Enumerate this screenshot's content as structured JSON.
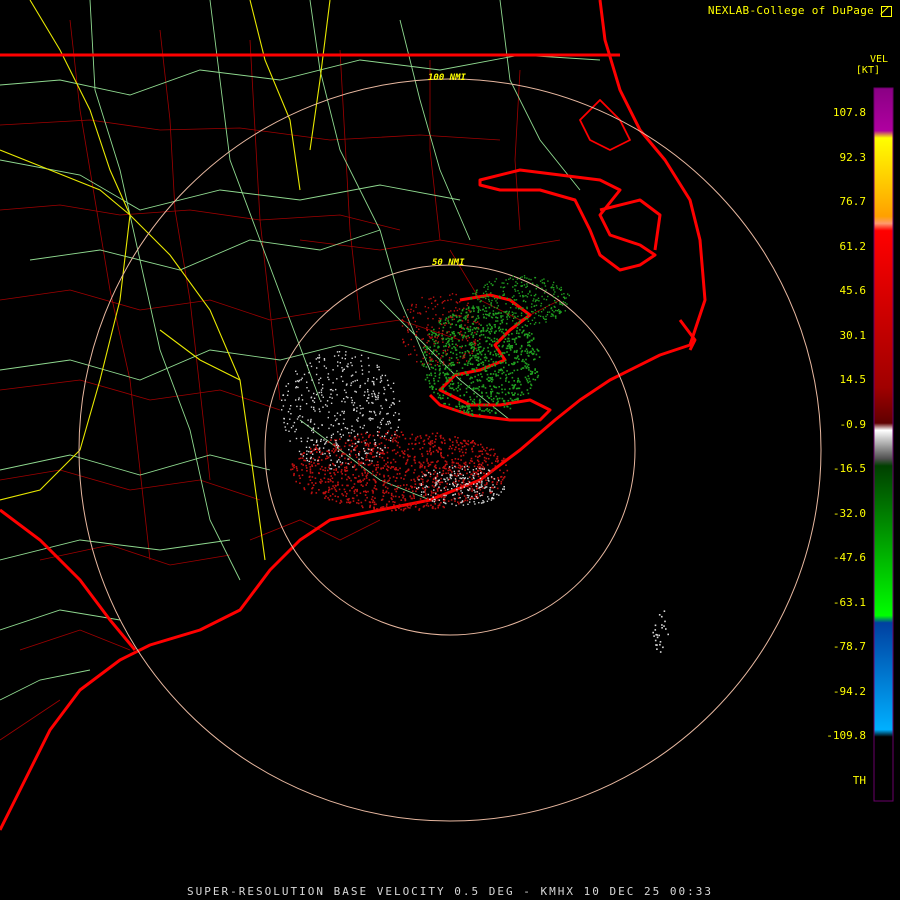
{
  "credit": "NEXLAB-College of DuPage",
  "footer": "SUPER-RESOLUTION BASE VELOCITY 0.5 DEG - KMHX 10 DEC 25 00:33",
  "legend": {
    "product": "VEL",
    "unit": "[KT]",
    "labels": [
      "107.8",
      "92.3",
      "76.7",
      "61.2",
      "45.6",
      "30.1",
      "14.5",
      "-0.9",
      "-16.5",
      "-32.0",
      "-47.6",
      "-63.1",
      "-78.7",
      "-94.2",
      "-109.8",
      "TH"
    ]
  },
  "range_rings": [
    "50 NMI",
    "100 NMI"
  ],
  "colors": {
    "background": "#000000",
    "state_borders": "#ff0000",
    "county_borders": "#b00000",
    "highways": "#9ce09c",
    "interstates": "#e8e800",
    "range_rings": "#e8b8a0",
    "text_accent": "#ffff00"
  },
  "icons": {
    "credit_logo": "nexlab-logo-icon"
  }
}
